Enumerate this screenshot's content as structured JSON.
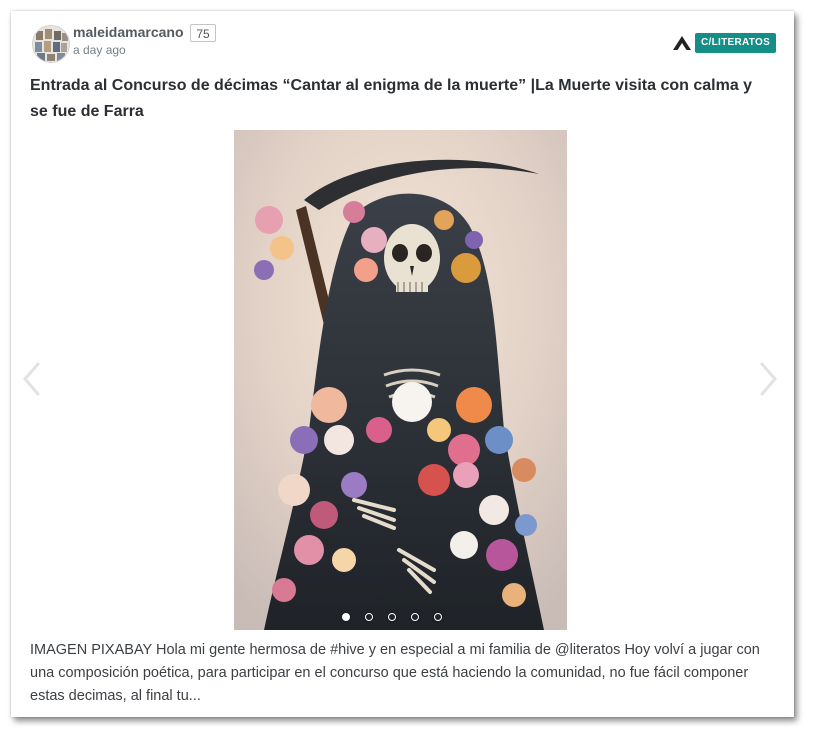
{
  "post": {
    "author": "maleidamarcano",
    "reputation": "75",
    "time": "a day ago",
    "community": "C/LITERATOS",
    "title": "Entrada al Concurso de décimas “Cantar al enigma de la muerte” |La Muerte visita con calma y se fue de Farra",
    "excerpt": "IMAGEN PIXABAY Hola mi gente hermosa de #hive y en especial a mi familia de @literatos Hoy volví a jugar con una composición poética, para participar en el concurso que está haciendo la comunidad, no fue fácil componer estas decimas, al final tu..."
  },
  "carousel": {
    "slide_count": 5,
    "active_index": 0,
    "image_subject": "skeleton-with-scythe-and-flowers"
  },
  "colors": {
    "community_tag_bg": "#158e88",
    "title": "#2b2f33",
    "username": "#555a60"
  },
  "icons": {
    "community": "community-logo-icon",
    "prev": "chevron-left-icon",
    "next": "chevron-right-icon"
  }
}
